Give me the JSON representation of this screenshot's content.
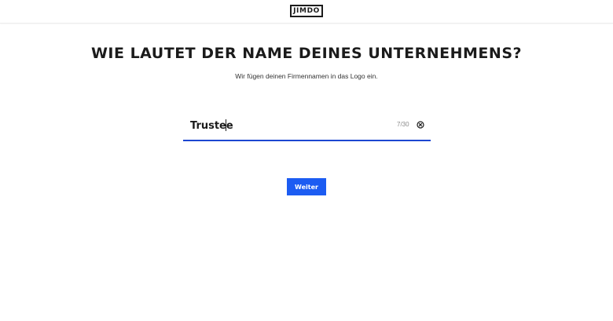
{
  "header": {
    "logo_text": "JIMDO",
    "logo_border_color": "#1b1b1b"
  },
  "main": {
    "title": "WIE LAUTET DER NAME DEINES UNTERNEHMENS?",
    "subtitle": "Wir fügen deinen Firmennamen in das Logo ein.",
    "company_field": {
      "value": "Trustee",
      "counter": "7/30",
      "clear_icon": "circle-x-icon",
      "underline_color": "#1c46d1"
    },
    "submit_label": "Weiter",
    "submit_color": "#1c5cf2"
  }
}
